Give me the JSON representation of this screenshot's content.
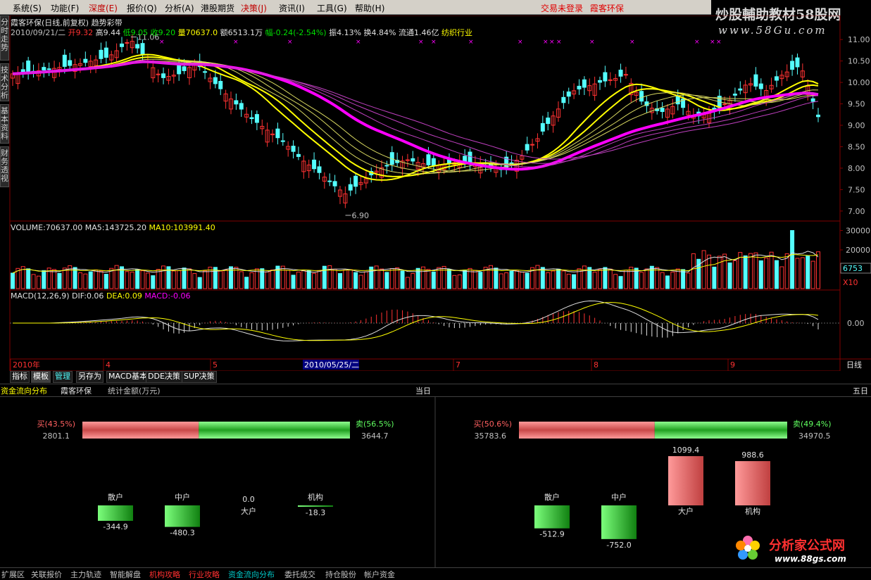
{
  "menu": {
    "items": [
      "系统(S)",
      "功能(F)",
      "深度(E)",
      "报价(Q)",
      "分析(A)",
      "港股期货",
      "决策(J)",
      "资讯(I)",
      "工具(G)",
      "帮助(H)"
    ],
    "red_items": [
      2,
      6
    ],
    "login_text": "交易未登录",
    "stock_link": "霞客环保"
  },
  "watermark": {
    "title": "炒股輔助教材58股网",
    "url": "www.58Gu.com"
  },
  "left_tabs": [
    "分时走势",
    "技术分析",
    "基本资料",
    "财务透视"
  ],
  "quote": {
    "line1": "霞客环保(日线,前复权) 趋势彩带",
    "date": "2010/09/21/二",
    "open": "开9.32",
    "high": "高9.44",
    "low": "低9.05",
    "close": "收9.20",
    "volume": "量70637.0",
    "amount": "额6513.1万",
    "change": "幅-0.24(-2.54%)",
    "amplitude": "振4.13%",
    "turnover": "换4.84%",
    "float": "流通1.46亿",
    "industry": "纺织行业"
  },
  "colors": {
    "up": "#ff3232",
    "down": "#54ffff",
    "ribbon_yellow": "#ffff00",
    "ribbon_magenta": "#ff00ff",
    "grid": "#800000"
  },
  "price_axis": {
    "labels": [
      "11.00",
      "10.50",
      "10.00",
      "9.50",
      "9.00",
      "8.50",
      "8.00",
      "7.50",
      "7.00"
    ],
    "ylim": [
      6.8,
      11.2
    ]
  },
  "price_marks": {
    "high_label": "11.06",
    "low_label": "6.90"
  },
  "volume_panel": {
    "header": "VOLUME:70637.00",
    "ma5": "MA5:143725.20",
    "ma10": "MA10:103991.40",
    "axis_labels": [
      "30000",
      "20000"
    ],
    "box_value": "6753",
    "box_unit": "X10"
  },
  "macd_panel": {
    "header": "MACD(12,26,9)",
    "dif": "DIF:0.06",
    "dea": "DEA:0.09",
    "macd": "MACD:-0.06",
    "axis_label": "0.00"
  },
  "time_axis": {
    "labels": [
      "2010年",
      "4",
      "5",
      "7",
      "8",
      "9"
    ],
    "cursor_label": "2010/05/25/二",
    "period": "日线"
  },
  "bottom_tabs": [
    "指标",
    "模板",
    "管理",
    "另存为",
    "MACD基本",
    "DDE决策",
    "SUP决策"
  ],
  "flow": {
    "title": "资金流向分布",
    "stock": "霞客环保",
    "unit": "统计金额(万元)",
    "left": {
      "period": "当日",
      "buy_label": "买(43.5%)",
      "buy_value": "2801.1",
      "sell_label": "卖(56.5%)",
      "sell_value": "3644.7",
      "buy_fraction": 0.435,
      "bars": [
        {
          "name": "散户",
          "value": "-344.9",
          "num": -344.9
        },
        {
          "name": "中户",
          "value": "-480.3",
          "num": -480.3
        },
        {
          "name": "大户",
          "value": "0.0",
          "num": 0.0
        },
        {
          "name": "机构",
          "value": "-18.3",
          "num": -18.3
        }
      ]
    },
    "right": {
      "period": "五日",
      "buy_label": "买(50.6%)",
      "buy_value": "35783.6",
      "sell_label": "卖(49.4%)",
      "sell_value": "34970.5",
      "buy_fraction": 0.506,
      "bars": [
        {
          "name": "散户",
          "value": "-512.9",
          "num": -512.9
        },
        {
          "name": "中户",
          "value": "-752.0",
          "num": -752.0
        },
        {
          "name": "大户",
          "value": "1099.4",
          "num": 1099.4
        },
        {
          "name": "机构",
          "value": "988.6",
          "num": 988.6
        }
      ]
    }
  },
  "bottom_bar": [
    "扩展区",
    "关联报价",
    "主力轨迹",
    "智能解盘",
    "机构攻略",
    "行业攻略",
    "资金流向分布",
    "委托成交",
    "持仓股份",
    "帐户资金"
  ],
  "bottom_bar_red": [
    4,
    5
  ],
  "bottom_bar_cyan": [
    6
  ],
  "watermark_bottom": {
    "title": "分析家公式网",
    "url": "www.88gs.com"
  }
}
